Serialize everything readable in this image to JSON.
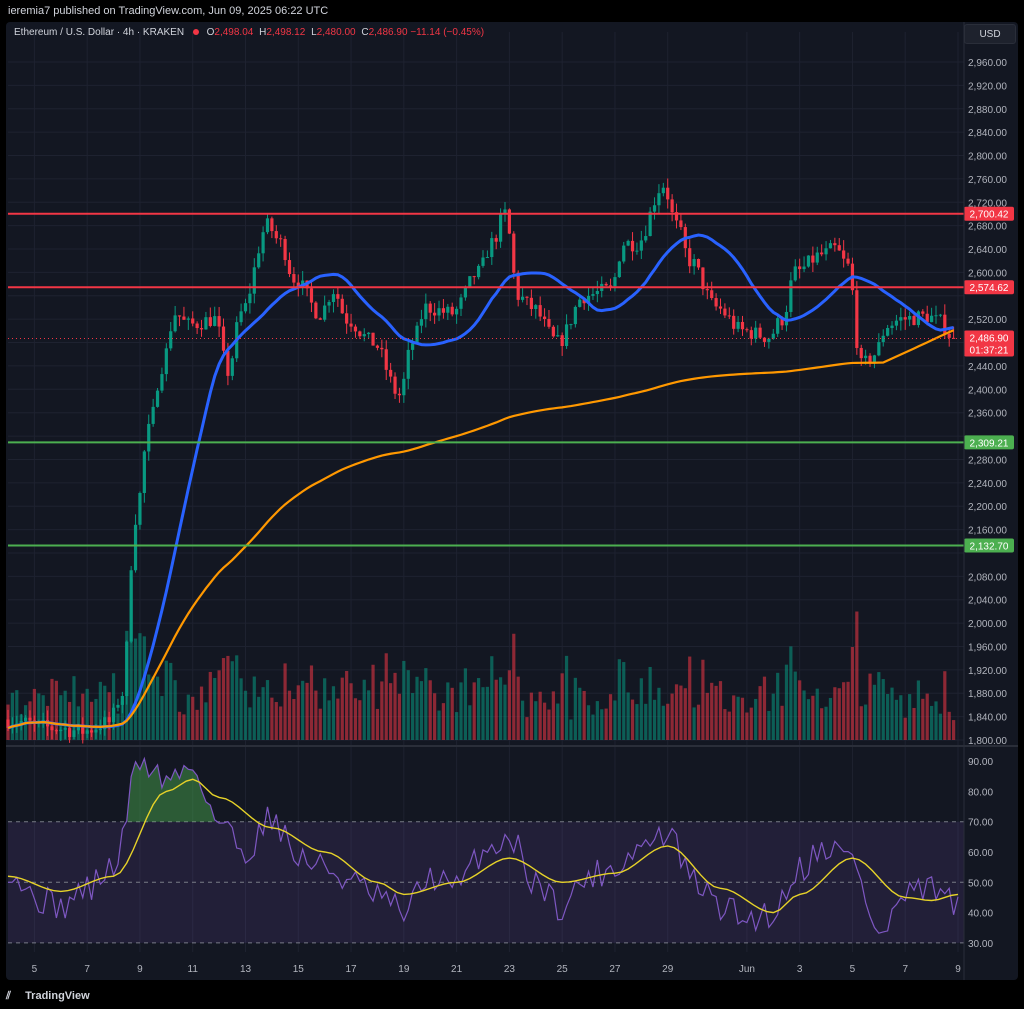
{
  "header": {
    "published": "ieremia7 published on TradingView.com, Jun 09, 2025 06:22 UTC"
  },
  "legend": {
    "symbol": "Ethereum / U.S. Dollar · 4h · KRAKEN",
    "o_label": "O",
    "o": "2,498.04",
    "h_label": "H",
    "h": "2,498.12",
    "l_label": "L",
    "l": "2,480.00",
    "c_label": "C",
    "c": "2,486.90",
    "change": "−11.14 (−0.45%)"
  },
  "currency_button": "USD",
  "footer": {
    "brand": "TradingView",
    "logo": "tradingview-logo"
  },
  "colors": {
    "background": "#131722",
    "up": "#089981",
    "down": "#f23645",
    "ma_fast": "#2962ff",
    "ma_slow": "#ff9800",
    "resistance": "#f23645",
    "support": "#4caf50",
    "rsi": "#7e57c2",
    "rsi_ma": "#e6d229"
  },
  "chart_data": [
    {
      "type": "candlestick",
      "title": "Ethereum / U.S. Dollar · 4h · KRAKEN",
      "ylim": [
        1800,
        2960
      ],
      "y_ticks": [
        1800,
        1840,
        1880,
        1920,
        1960,
        2000,
        2040,
        2080,
        2120,
        2160,
        2200,
        2240,
        2280,
        2320,
        2360,
        2400,
        2440,
        2480,
        2520,
        2560,
        2600,
        2640,
        2680,
        2720,
        2760,
        2800,
        2840,
        2880,
        2920,
        2960
      ],
      "x_tick_labels": [
        "5",
        "7",
        "9",
        "11",
        "13",
        "15",
        "17",
        "19",
        "21",
        "23",
        "25",
        "27",
        "29",
        "Jun",
        "3",
        "5",
        "7",
        "9"
      ],
      "price_anchors": [
        [
          "May 4",
          1835
        ],
        [
          "May 6",
          1820
        ],
        [
          "May 7",
          1815
        ],
        [
          "May 8",
          1830
        ],
        [
          "May 8 12h",
          1880
        ],
        [
          "May 9",
          2180
        ],
        [
          "May 9 12h",
          2330
        ],
        [
          "May 10",
          2440
        ],
        [
          "May 10 12h",
          2530
        ],
        [
          "May 11",
          2510
        ],
        [
          "May 12",
          2520
        ],
        [
          "May 12 12h",
          2430
        ],
        [
          "May 13",
          2530
        ],
        [
          "May 14",
          2680
        ],
        [
          "May 14 12h",
          2650
        ],
        [
          "May 15",
          2590
        ],
        [
          "May 16",
          2530
        ],
        [
          "May 16 12h",
          2570
        ],
        [
          "May 17",
          2520
        ],
        [
          "May 18",
          2480
        ],
        [
          "May 19",
          2390
        ],
        [
          "May 19 12h",
          2480
        ],
        [
          "May 20",
          2540
        ],
        [
          "May 21",
          2530
        ],
        [
          "May 22",
          2600
        ],
        [
          "May 22 12h",
          2650
        ],
        [
          "May 23",
          2700
        ],
        [
          "May 23 12h",
          2560
        ],
        [
          "May 24",
          2540
        ],
        [
          "May 25",
          2480
        ],
        [
          "May 26",
          2560
        ],
        [
          "May 27",
          2570
        ],
        [
          "May 27 12h",
          2650
        ],
        [
          "May 28",
          2650
        ],
        [
          "May 29",
          2750
        ],
        [
          "May 29 12h",
          2680
        ],
        [
          "May 30",
          2620
        ],
        [
          "May 31",
          2540
        ],
        [
          "Jun 1",
          2500
        ],
        [
          "Jun 2",
          2490
        ],
        [
          "Jun 2 12h",
          2520
        ],
        [
          "Jun 3",
          2600
        ],
        [
          "Jun 4",
          2630
        ],
        [
          "Jun 4 12h",
          2640
        ],
        [
          "Jun 5",
          2610
        ],
        [
          "Jun 5 12h",
          2440
        ],
        [
          "Jun 6",
          2460
        ],
        [
          "Jun 6 12h",
          2510
        ],
        [
          "Jun 7",
          2520
        ],
        [
          "Jun 8",
          2525
        ],
        [
          "Jun 8 12h",
          2515
        ],
        [
          "Jun 9",
          2487
        ]
      ],
      "last_price": {
        "value": 2486.9,
        "label": "2,486.90",
        "countdown": "01:37:21"
      },
      "horizontal_levels": [
        {
          "value": 2700.42,
          "label": "2,700.42",
          "kind": "resistance"
        },
        {
          "value": 2574.62,
          "label": "2,574.62",
          "kind": "resistance"
        },
        {
          "value": 2309.21,
          "label": "2,309.21",
          "kind": "support"
        },
        {
          "value": 2132.7,
          "label": "2,132.70",
          "kind": "support"
        }
      ],
      "volume": "histogram at bottom of price pane, colored by candle direction"
    },
    {
      "type": "line",
      "title": "RSI",
      "ylim": [
        27,
        93
      ],
      "y_ticks": [
        30,
        40,
        50,
        60,
        70,
        80,
        90
      ],
      "band": [
        30,
        70
      ],
      "midline": 50,
      "rsi_anchors": [
        [
          "May 4",
          55
        ],
        [
          "May 5",
          45
        ],
        [
          "May 6",
          42
        ],
        [
          "May 7",
          48
        ],
        [
          "May 8",
          55
        ],
        [
          "May 9",
          90
        ],
        [
          "May 10",
          84
        ],
        [
          "May 11",
          88
        ],
        [
          "May 12",
          70
        ],
        [
          "May 13",
          60
        ],
        [
          "May 14",
          72
        ],
        [
          "May 15",
          58
        ],
        [
          "May 16",
          55
        ],
        [
          "May 17",
          50
        ],
        [
          "May 18",
          45
        ],
        [
          "May 19",
          40
        ],
        [
          "May 20",
          52
        ],
        [
          "May 21",
          48
        ],
        [
          "May 22",
          60
        ],
        [
          "May 23",
          65
        ],
        [
          "May 24",
          50
        ],
        [
          "May 25",
          42
        ],
        [
          "May 26",
          52
        ],
        [
          "May 27",
          55
        ],
        [
          "May 28",
          62
        ],
        [
          "May 29",
          66
        ],
        [
          "May 30",
          50
        ],
        [
          "May 31",
          42
        ],
        [
          "Jun 1",
          38
        ],
        [
          "Jun 2",
          40
        ],
        [
          "Jun 3",
          55
        ],
        [
          "Jun 4",
          62
        ],
        [
          "Jun 5",
          58
        ],
        [
          "Jun 6",
          32
        ],
        [
          "Jun 7",
          45
        ],
        [
          "Jun 8",
          48
        ],
        [
          "Jun 9",
          42
        ]
      ],
      "ma_anchors": [
        [
          "May 4",
          52
        ],
        [
          "May 6",
          47
        ],
        [
          "May 8",
          52
        ],
        [
          "May 10",
          80
        ],
        [
          "May 11",
          84
        ],
        [
          "May 12",
          78
        ],
        [
          "May 14",
          68
        ],
        [
          "May 16",
          60
        ],
        [
          "May 18",
          50
        ],
        [
          "May 19",
          46
        ],
        [
          "May 21",
          50
        ],
        [
          "May 23",
          58
        ],
        [
          "May 25",
          50
        ],
        [
          "May 27",
          53
        ],
        [
          "May 29",
          62
        ],
        [
          "May 31",
          48
        ],
        [
          "Jun 2",
          40
        ],
        [
          "Jun 3",
          46
        ],
        [
          "Jun 5",
          58
        ],
        [
          "Jun 7",
          45
        ],
        [
          "Jun 8",
          44
        ],
        [
          "Jun 9",
          46
        ]
      ]
    }
  ]
}
